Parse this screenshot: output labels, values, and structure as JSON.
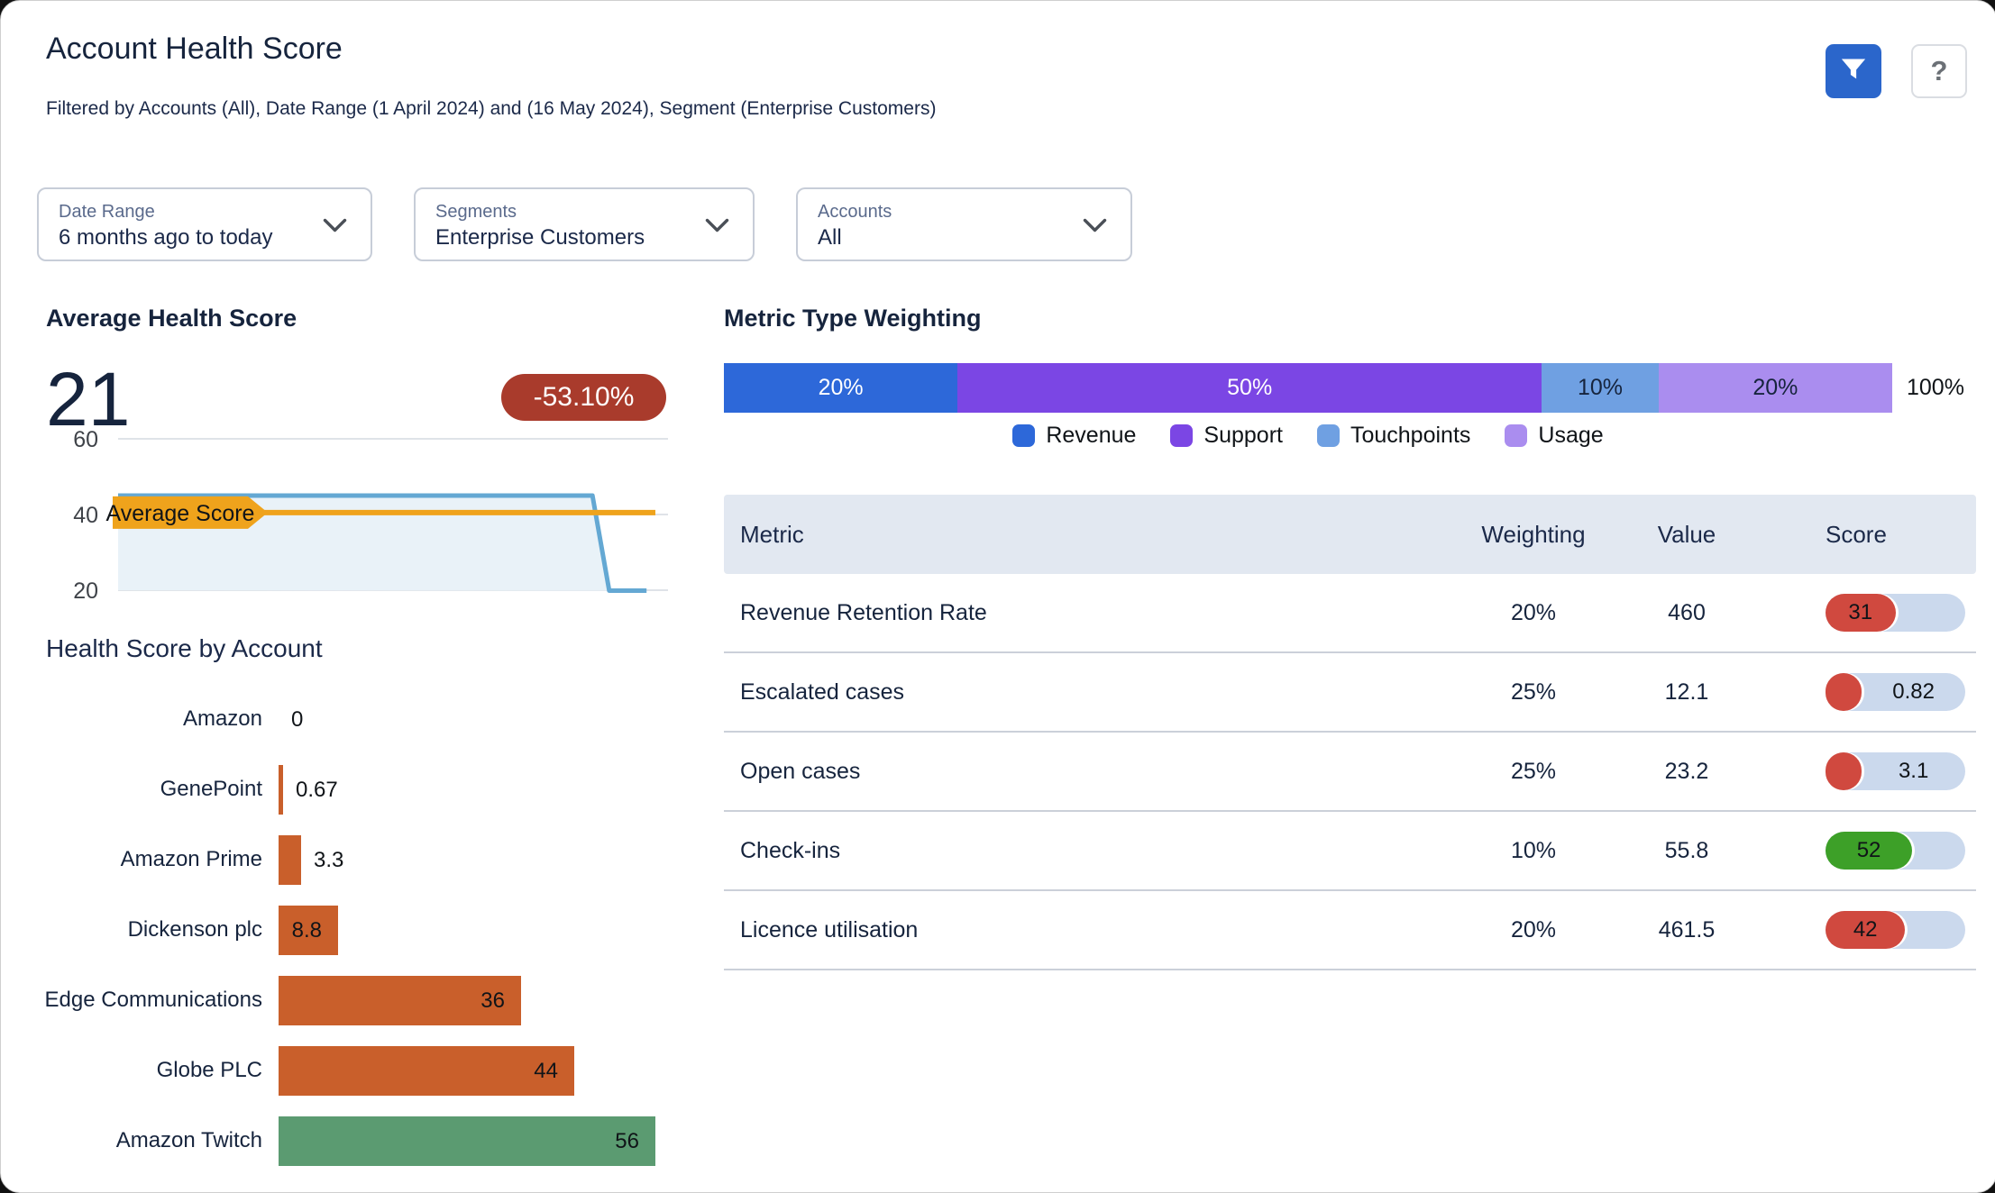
{
  "header": {
    "title": "Account Health Score",
    "subtitle": "Filtered by Accounts (All), Date Range (1 April 2024) and (16 May 2024), Segment (Enterprise Customers)",
    "filter_button_color": "#2B66CB",
    "help_label": "?"
  },
  "filters": [
    {
      "label": "Date Range",
      "value": "6 months ago to today"
    },
    {
      "label": "Segments",
      "value": "Enterprise Customers"
    },
    {
      "label": "Accounts",
      "value": "All"
    }
  ],
  "avg": {
    "heading": "Average Health Score",
    "value": "21",
    "delta": "-53.10%",
    "delta_bg": "#A93B2C"
  },
  "chart_data": [
    {
      "name": "average-score-trend",
      "type": "area",
      "title": "Average Health Score",
      "y_ticks": [
        60,
        40,
        20
      ],
      "ylim": [
        20,
        60
      ],
      "grid": true,
      "line_color": "#64A8D3",
      "area_color": "#E9F2F8",
      "points": [
        [
          0,
          45
        ],
        [
          87.7,
          45
        ],
        [
          90.8,
          19.6
        ],
        [
          97.7,
          19.6
        ]
      ],
      "reference_line": {
        "label": "Average Score",
        "value": 40.5,
        "color": "#EFA31C"
      }
    },
    {
      "name": "health-score-by-account",
      "type": "bar",
      "title": "Health Score by Account",
      "orientation": "horizontal",
      "categories": [
        "Amazon",
        "GenePoint",
        "Amazon Prime",
        "Dickenson plc",
        "Edge Communications",
        "Globe PLC",
        "Amazon Twitch"
      ],
      "values": [
        0,
        0.67,
        3.3,
        8.8,
        36,
        44,
        56
      ],
      "value_labels": [
        "0",
        "0.67",
        "3.3",
        "8.8",
        "36",
        "44",
        "56"
      ],
      "colors": [
        "#C95F2B",
        "#C95F2B",
        "#C95F2B",
        "#C95F2B",
        "#C95F2B",
        "#C95F2B",
        "#5B9B71"
      ],
      "xlim": [
        0,
        58
      ]
    },
    {
      "name": "metric-type-weighting",
      "type": "stacked-bar",
      "title": "Metric Type Weighting",
      "total_label": "100%",
      "legend_position": "bottom-center",
      "segments": [
        {
          "label": "Revenue",
          "pct": 20,
          "color": "#2D68D9",
          "text_color": "#FFFFFF",
          "value_label": "20%"
        },
        {
          "label": "Support",
          "pct": 50,
          "color": "#7B46E4",
          "text_color": "#FFFFFF",
          "value_label": "50%"
        },
        {
          "label": "Touchpoints",
          "pct": 10,
          "color": "#6FA0E2",
          "text_color": "#16243D",
          "value_label": "10%"
        },
        {
          "label": "Usage",
          "pct": 20,
          "color": "#AA8DEF",
          "text_color": "#16243D",
          "value_label": "20%"
        }
      ]
    }
  ],
  "table": {
    "columns": [
      "Metric",
      "Weighting",
      "Value",
      "Score"
    ],
    "track_color": "#CBD9ED",
    "rows": [
      {
        "metric": "Revenue Retention Rate",
        "weighting": "20%",
        "value": "460",
        "score": "31",
        "score_color": "#D0493F",
        "fill_pct": 50,
        "label_in_fill": true
      },
      {
        "metric": "Escalated cases",
        "weighting": "25%",
        "value": "12.1",
        "score": "0.82",
        "score_color": "#D0493F",
        "fill_pct": 26,
        "label_in_fill": false
      },
      {
        "metric": "Open cases",
        "weighting": "25%",
        "value": "23.2",
        "score": "3.1",
        "score_color": "#D0493F",
        "fill_pct": 26,
        "label_in_fill": false
      },
      {
        "metric": "Check-ins",
        "weighting": "10%",
        "value": "55.8",
        "score": "52",
        "score_color": "#3DA028",
        "fill_pct": 62,
        "label_in_fill": true
      },
      {
        "metric": "Licence utilisation",
        "weighting": "20%",
        "value": "461.5",
        "score": "42",
        "score_color": "#D0493F",
        "fill_pct": 57,
        "label_in_fill": true
      }
    ]
  }
}
